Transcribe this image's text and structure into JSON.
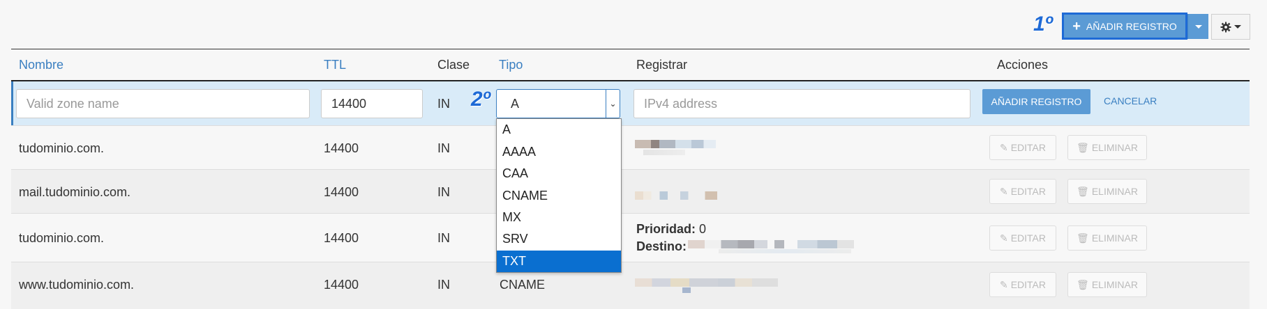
{
  "toolbar": {
    "step1": "1º",
    "add_record_label": "AÑADIR REGISTRO"
  },
  "table": {
    "headers": [
      "Nombre",
      "TTL",
      "Clase",
      "Tipo",
      "Registrar",
      "Acciones"
    ],
    "edit_row": {
      "step2": "2º",
      "name_placeholder": "Valid zone name",
      "ttl_value": "14400",
      "class_value": "IN",
      "type_selected": "A",
      "record_placeholder": "IPv4 address",
      "add_button": "AÑADIR REGISTRO",
      "cancel_link": "CANCELAR"
    },
    "type_options": [
      "A",
      "AAAA",
      "CAA",
      "CNAME",
      "MX",
      "SRV",
      "TXT"
    ],
    "highlighted_option": "TXT",
    "rows": [
      {
        "name": "tudominio.com.",
        "ttl": "14400",
        "class": "IN",
        "type": ""
      },
      {
        "name": "mail.tudominio.com.",
        "ttl": "14400",
        "class": "IN",
        "type": ""
      },
      {
        "name": "tudominio.com.",
        "ttl": "14400",
        "class": "IN",
        "type": "",
        "priority_label": "Prioridad:",
        "priority_value": "0",
        "dest_label": "Destino:"
      },
      {
        "name": "www.tudominio.com.",
        "ttl": "14400",
        "class": "IN",
        "type": "CNAME"
      }
    ],
    "edit_label": "EDITAR",
    "delete_label": "ELIMINAR"
  },
  "colors": {
    "accent": "#1e6ad6",
    "button_blue": "#5b9bd5",
    "link": "#3a7fc1",
    "edit_row_bg": "#d9ebf8",
    "selected_option": "#0a6fd0"
  },
  "icons": [
    "plus-icon",
    "gear-icon",
    "chevron-down-icon",
    "pencil-icon",
    "trash-icon"
  ]
}
